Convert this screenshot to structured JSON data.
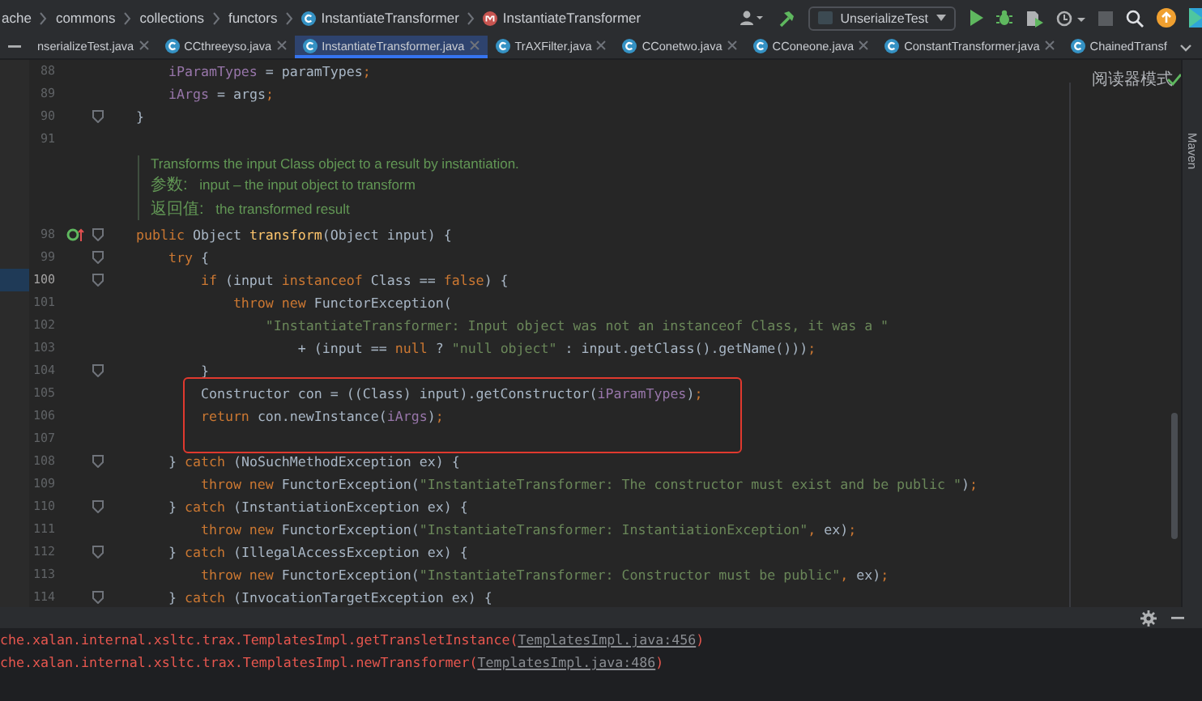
{
  "breadcrumbs": [
    {
      "label": "ache",
      "kind": "package"
    },
    {
      "label": "commons",
      "kind": "package"
    },
    {
      "label": "collections",
      "kind": "package"
    },
    {
      "label": "functors",
      "kind": "package"
    },
    {
      "label": "InstantiateTransformer",
      "kind": "class"
    },
    {
      "label": "InstantiateTransformer",
      "kind": "method"
    }
  ],
  "toolbar": {
    "run_config": "UnserializeTest"
  },
  "tabs": [
    {
      "label": "nserializeTest.java",
      "selected": false,
      "closable": true
    },
    {
      "label": "CCthreeyso.java",
      "selected": false,
      "closable": true
    },
    {
      "label": "InstantiateTransformer.java",
      "selected": true,
      "closable": true
    },
    {
      "label": "TrAXFilter.java",
      "selected": false,
      "closable": true
    },
    {
      "label": "CConetwo.java",
      "selected": false,
      "closable": true
    },
    {
      "label": "CConeone.java",
      "selected": false,
      "closable": true
    },
    {
      "label": "ConstantTransformer.java",
      "selected": false,
      "closable": true
    },
    {
      "label": "ChainedTransf",
      "selected": false,
      "closable": false
    }
  ],
  "editor": {
    "reader_mode": "阅读器模式",
    "lines": [
      {
        "kind": "code",
        "n": "88",
        "current": false,
        "tokens": [
          {
            "kind": "field",
            "t": "    iParamTypes"
          },
          {
            "kind": "plain",
            "t": " = paramTypes"
          },
          {
            "kind": "kw",
            "t": ";"
          }
        ]
      },
      {
        "kind": "code",
        "n": "89",
        "current": false,
        "tokens": [
          {
            "kind": "field",
            "t": "    iArgs"
          },
          {
            "kind": "plain",
            "t": " = args"
          },
          {
            "kind": "kw",
            "t": ";"
          }
        ]
      },
      {
        "kind": "code",
        "n": "90",
        "current": false,
        "markers": [
          {
            "kind": "fold"
          }
        ],
        "tokens": [
          {
            "kind": "plain",
            "t": "}"
          }
        ]
      },
      {
        "kind": "code",
        "n": "91",
        "current": false
      },
      {
        "kind": "doc",
        "summary": "Transforms the input Class object to a result by instantiation.",
        "tags": [
          {
            "label": "参数:",
            "text": "input – the input object to transform"
          },
          {
            "label": "返回值:",
            "text": "the transformed result"
          }
        ]
      },
      {
        "kind": "code",
        "n": "98",
        "current": false,
        "markers": [
          {
            "kind": "override"
          },
          {
            "kind": "fold"
          }
        ],
        "tokens": [
          {
            "kind": "kw",
            "t": "public "
          },
          {
            "kind": "plain",
            "t": "Object "
          },
          {
            "kind": "method",
            "t": "transform"
          },
          {
            "kind": "plain",
            "t": "(Object input) {"
          }
        ]
      },
      {
        "kind": "code",
        "n": "99",
        "current": false,
        "markers": [
          {
            "kind": "fold"
          }
        ],
        "tokens": [
          {
            "kind": "kw",
            "t": "    try"
          },
          {
            "kind": "plain",
            "t": " {"
          }
        ]
      },
      {
        "kind": "code",
        "n": "100",
        "current": true,
        "markers": [
          {
            "kind": "fold"
          }
        ],
        "tokens": [
          {
            "kind": "kw",
            "t": "        if"
          },
          {
            "kind": "plain",
            "t": " (input "
          },
          {
            "kind": "kw",
            "t": "instanceof"
          },
          {
            "kind": "plain",
            "t": " Class == "
          },
          {
            "kind": "kw",
            "t": "false"
          },
          {
            "kind": "plain",
            "t": ") {"
          }
        ]
      },
      {
        "kind": "code",
        "n": "101",
        "current": false,
        "tokens": [
          {
            "kind": "kw",
            "t": "            throw new "
          },
          {
            "kind": "plain",
            "t": "FunctorException("
          }
        ]
      },
      {
        "kind": "code",
        "n": "102",
        "current": false,
        "tokens": [
          {
            "kind": "str",
            "t": "                \"InstantiateTransformer: Input object was not an instanceof Class, it was a \""
          }
        ]
      },
      {
        "kind": "code",
        "n": "103",
        "current": false,
        "tokens": [
          {
            "kind": "plain",
            "t": "                    + (input == "
          },
          {
            "kind": "kw",
            "t": "null"
          },
          {
            "kind": "plain",
            "t": " ? "
          },
          {
            "kind": "str",
            "t": "\"null object\""
          },
          {
            "kind": "plain",
            "t": " : input.getClass().getName()))"
          },
          {
            "kind": "kw",
            "t": ";"
          }
        ]
      },
      {
        "kind": "code",
        "n": "104",
        "current": false,
        "markers": [
          {
            "kind": "fold"
          }
        ],
        "tokens": [
          {
            "kind": "plain",
            "t": "        }"
          }
        ]
      },
      {
        "kind": "code",
        "n": "105",
        "current": false,
        "tokens": [
          {
            "kind": "plain",
            "t": "        Constructor con = ((Class) input).getConstructor("
          },
          {
            "kind": "field",
            "t": "iParamTypes"
          },
          {
            "kind": "plain",
            "t": ")"
          },
          {
            "kind": "kw",
            "t": ";"
          }
        ]
      },
      {
        "kind": "code",
        "n": "106",
        "current": false,
        "tokens": [
          {
            "kind": "kw",
            "t": "        return "
          },
          {
            "kind": "plain",
            "t": "con.newInstance("
          },
          {
            "kind": "field",
            "t": "iArgs"
          },
          {
            "kind": "plain",
            "t": ")"
          },
          {
            "kind": "kw",
            "t": ";"
          }
        ]
      },
      {
        "kind": "code",
        "n": "107",
        "current": false
      },
      {
        "kind": "code",
        "n": "108",
        "current": false,
        "markers": [
          {
            "kind": "fold"
          }
        ],
        "tokens": [
          {
            "kind": "plain",
            "t": "    } "
          },
          {
            "kind": "kw",
            "t": "catch"
          },
          {
            "kind": "plain",
            "t": " (NoSuchMethodException ex) {"
          }
        ]
      },
      {
        "kind": "code",
        "n": "109",
        "current": false,
        "tokens": [
          {
            "kind": "kw",
            "t": "        throw new "
          },
          {
            "kind": "plain",
            "t": "FunctorException("
          },
          {
            "kind": "str",
            "t": "\"InstantiateTransformer: The constructor must exist and be public \""
          },
          {
            "kind": "plain",
            "t": ")"
          },
          {
            "kind": "kw",
            "t": ";"
          }
        ]
      },
      {
        "kind": "code",
        "n": "110",
        "current": false,
        "markers": [
          {
            "kind": "fold"
          }
        ],
        "tokens": [
          {
            "kind": "plain",
            "t": "    } "
          },
          {
            "kind": "kw",
            "t": "catch"
          },
          {
            "kind": "plain",
            "t": " (InstantiationException ex) {"
          }
        ]
      },
      {
        "kind": "code",
        "n": "111",
        "current": false,
        "tokens": [
          {
            "kind": "kw",
            "t": "        throw new "
          },
          {
            "kind": "plain",
            "t": "FunctorException("
          },
          {
            "kind": "str",
            "t": "\"InstantiateTransformer: InstantiationException\""
          },
          {
            "kind": "kw",
            "t": ", "
          },
          {
            "kind": "plain",
            "t": "ex)"
          },
          {
            "kind": "kw",
            "t": ";"
          }
        ]
      },
      {
        "kind": "code",
        "n": "112",
        "current": false,
        "markers": [
          {
            "kind": "fold"
          }
        ],
        "tokens": [
          {
            "kind": "plain",
            "t": "    } "
          },
          {
            "kind": "kw",
            "t": "catch"
          },
          {
            "kind": "plain",
            "t": " (IllegalAccessException ex) {"
          }
        ]
      },
      {
        "kind": "code",
        "n": "113",
        "current": false,
        "tokens": [
          {
            "kind": "kw",
            "t": "        throw new "
          },
          {
            "kind": "plain",
            "t": "FunctorException("
          },
          {
            "kind": "str",
            "t": "\"InstantiateTransformer: Constructor must be public\""
          },
          {
            "kind": "kw",
            "t": ", "
          },
          {
            "kind": "plain",
            "t": "ex)"
          },
          {
            "kind": "kw",
            "t": ";"
          }
        ]
      },
      {
        "kind": "code",
        "n": "114",
        "current": false,
        "markers": [
          {
            "kind": "fold"
          }
        ],
        "tokens": [
          {
            "kind": "plain",
            "t": "    } "
          },
          {
            "kind": "kw",
            "t": "catch"
          },
          {
            "kind": "plain",
            "t": " (InvocationTargetException ex) {"
          }
        ]
      }
    ]
  },
  "console": {
    "lines": [
      {
        "text": "che.xalan.internal.xsltc.trax.TemplatesImpl.getTransletInstance(",
        "link": "TemplatesImpl.java:456",
        "end": ")"
      },
      {
        "text": "che.xalan.internal.xsltc.trax.TemplatesImpl.newTransformer(",
        "link": "TemplatesImpl.java:486",
        "end": ")"
      }
    ]
  },
  "side_panel": {
    "label": "Maven"
  }
}
